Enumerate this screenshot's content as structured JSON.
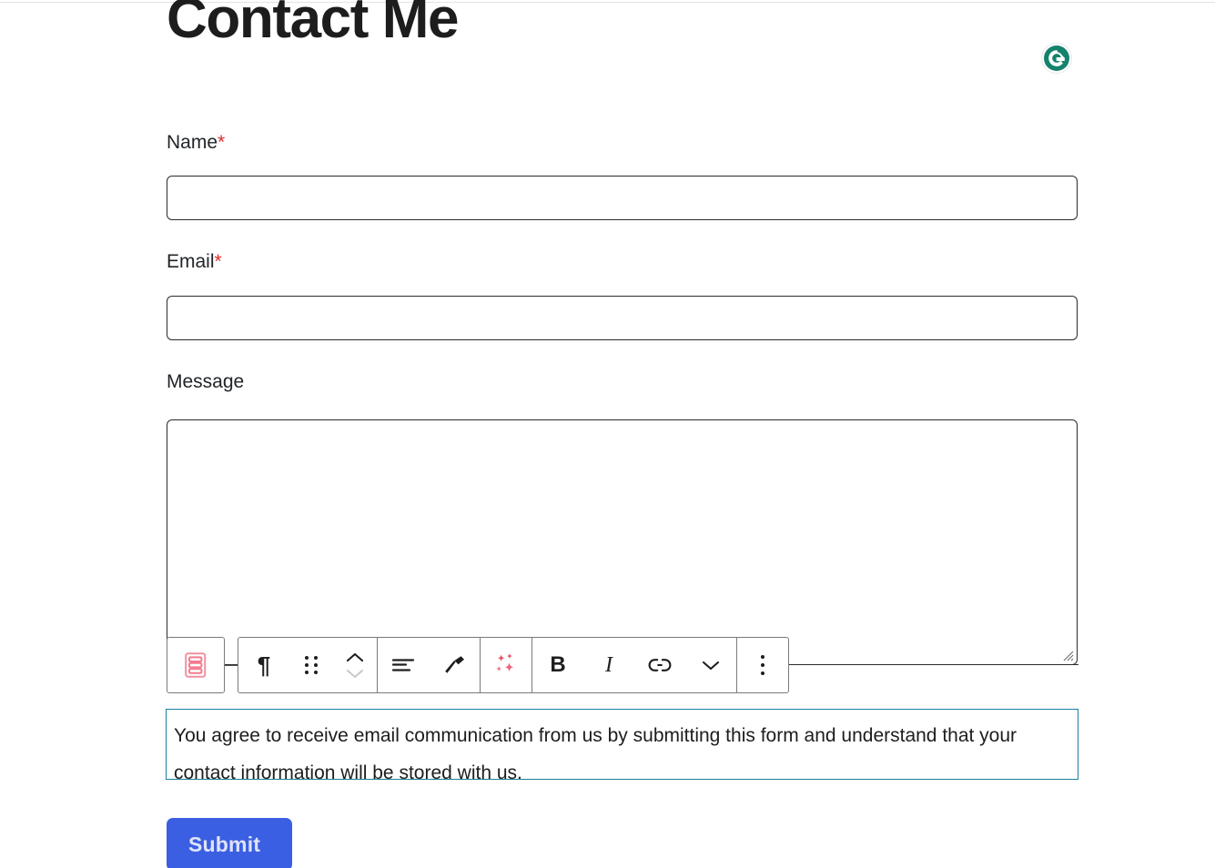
{
  "page": {
    "title": "Contact Me"
  },
  "badges": {
    "grammarly": {
      "name": "grammarly-icon",
      "color": "#15836b",
      "letter": "G"
    }
  },
  "form": {
    "fields": [
      {
        "id": "name",
        "label": "Name",
        "required": true,
        "required_marker": "*",
        "value": "",
        "placeholder": ""
      },
      {
        "id": "email",
        "label": "Email",
        "required": true,
        "required_marker": "*",
        "value": "",
        "placeholder": ""
      },
      {
        "id": "message",
        "label": "Message",
        "required": false,
        "required_marker": "",
        "value": "",
        "placeholder": ""
      }
    ],
    "consent_text": "You agree to receive email communication from us by submitting this form and understand that your contact information will be stored with us.",
    "consent_border_color": "#1b7f9e",
    "submit_label": "Submit",
    "submit_color": "#3b5fe2"
  },
  "editor_toolbar": {
    "lead_button": {
      "name": "form-block-icon",
      "label": "Form block",
      "color": "#f2909e"
    },
    "buttons": [
      {
        "name": "paragraph-block-icon",
        "label": "Paragraph",
        "glyph": "¶"
      },
      {
        "name": "drag-handle-icon",
        "label": "Drag",
        "glyph": "dots-grid"
      },
      {
        "name": "move-up-down-icon",
        "label": "Move up or down",
        "glyph": "chevron-stack"
      },
      {
        "name": "align-text-icon",
        "label": "Align text",
        "glyph": "align-left"
      },
      {
        "name": "highlight-icon",
        "label": "Highlight",
        "glyph": "hammer"
      },
      {
        "name": "ai-sparkles-icon",
        "label": "AI assistant",
        "glyph": "sparkles",
        "color": "#e8455f"
      },
      {
        "name": "bold-icon",
        "label": "Bold",
        "glyph": "B"
      },
      {
        "name": "italic-icon",
        "label": "Italic",
        "glyph": "I"
      },
      {
        "name": "link-icon",
        "label": "Link",
        "glyph": "link"
      },
      {
        "name": "chevron-down-icon",
        "label": "More formatting",
        "glyph": "chevron-down"
      },
      {
        "name": "options-menu-icon",
        "label": "Options",
        "glyph": "dots-vertical"
      }
    ]
  }
}
